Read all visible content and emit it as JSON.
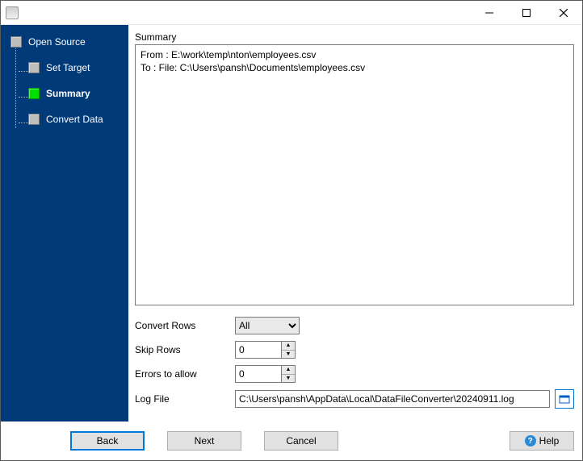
{
  "titlebar": {
    "title": ""
  },
  "sidebar": {
    "steps": [
      {
        "label": "Open Source",
        "active": false
      },
      {
        "label": "Set Target",
        "active": false
      },
      {
        "label": "Summary",
        "active": true
      },
      {
        "label": "Convert Data",
        "active": false
      }
    ]
  },
  "main": {
    "heading": "Summary",
    "summary_lines": {
      "from": "From : E:\\work\\temp\\nton\\employees.csv",
      "to": "To : File: C:\\Users\\pansh\\Documents\\employees.csv"
    },
    "fields": {
      "convert_rows": {
        "label": "Convert Rows",
        "value": "All",
        "options": [
          "All"
        ]
      },
      "skip_rows": {
        "label": "Skip Rows",
        "value": "0"
      },
      "errors_to_allow": {
        "label": "Errors to allow",
        "value": "0"
      },
      "log_file": {
        "label": "Log File",
        "value": "C:\\Users\\pansh\\AppData\\Local\\DataFileConverter\\20240911.log"
      }
    }
  },
  "footer": {
    "back": "Back",
    "next": "Next",
    "cancel": "Cancel",
    "help": "Help"
  }
}
